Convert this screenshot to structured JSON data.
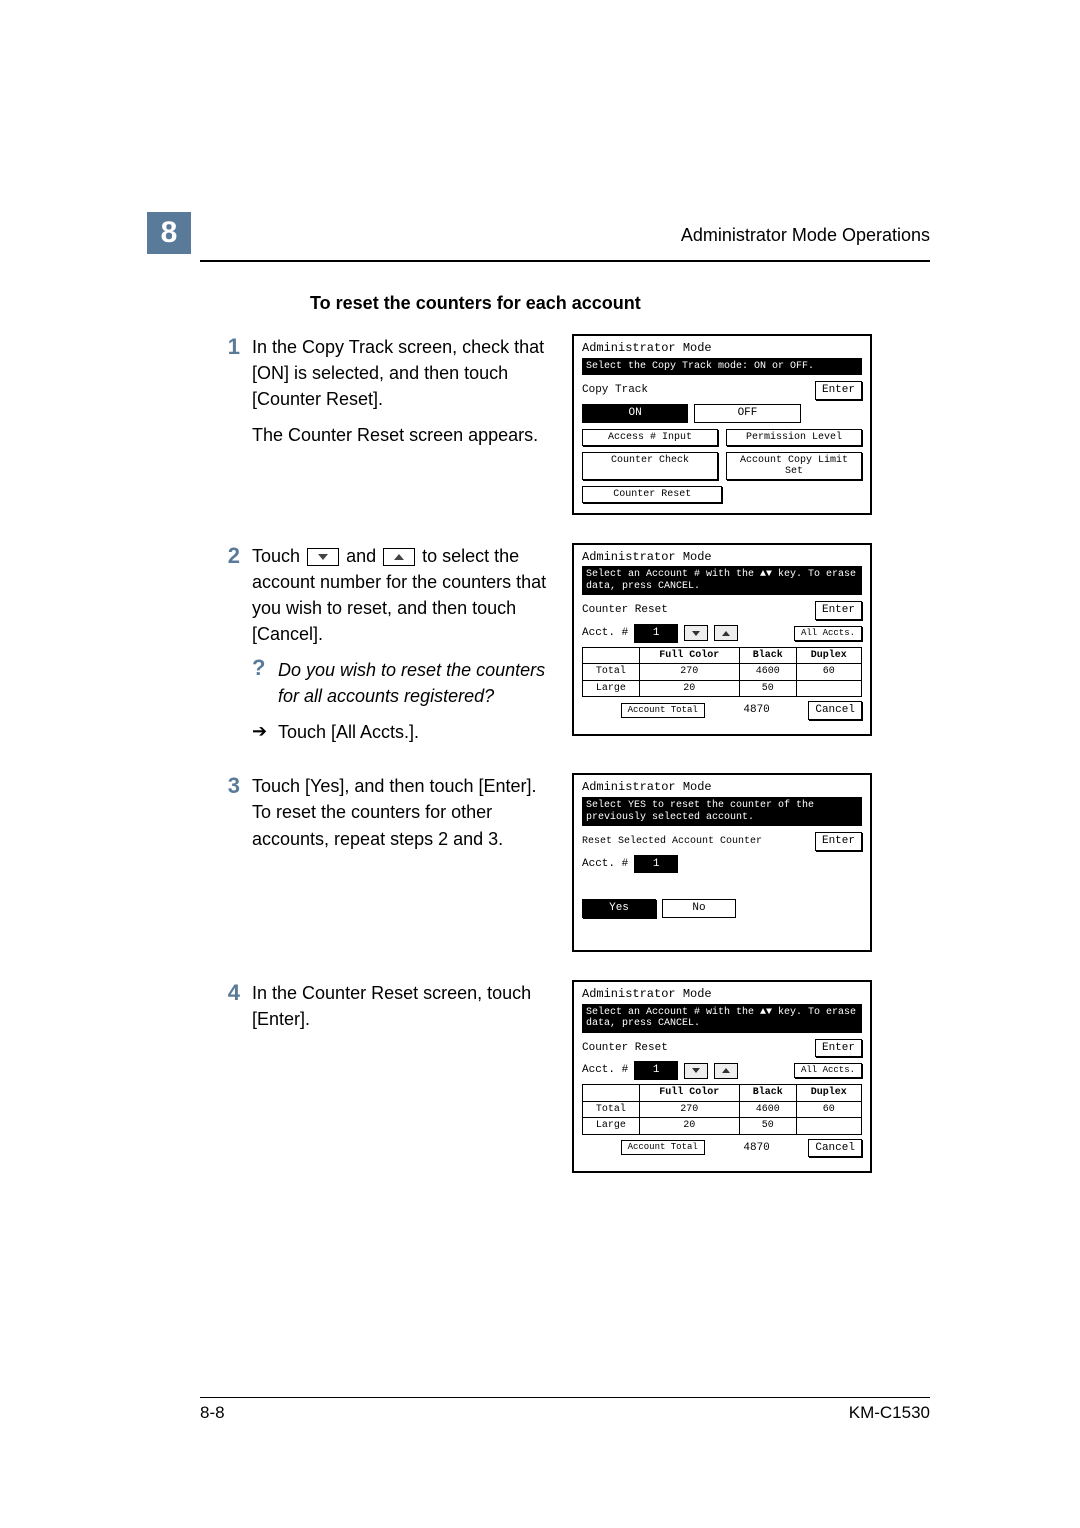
{
  "header": {
    "chapter_number": "8",
    "right_title": "Administrator Mode Operations"
  },
  "section_heading": "To reset the counters for each account",
  "steps": {
    "s1": {
      "num": "1",
      "p1": "In the Copy Track screen, check that [ON] is selected, and then touch [Counter Reset].",
      "p2": "The Counter Reset screen appears."
    },
    "s2": {
      "num": "2",
      "pre": "Touch ",
      "mid": " and ",
      "post": " to select the account number for the counters that you wish to reset, and then touch [Cancel].",
      "q": "Do you wish to reset the counters for all accounts registered?",
      "arrow_text": "Touch [All Accts.]."
    },
    "s3": {
      "num": "3",
      "p1": "Touch [Yes], and then touch [Enter]. To reset the counters for other accounts, repeat steps 2 and 3."
    },
    "s4": {
      "num": "4",
      "p1": "In the Counter Reset screen, touch [Enter]."
    }
  },
  "panels": {
    "p1": {
      "title": "Administrator Mode",
      "msg": "Select the Copy Track mode: ON or OFF.",
      "copy_track": "Copy Track",
      "enter": "Enter",
      "on": "ON",
      "off": "OFF",
      "b1": "Access # Input",
      "b2": "Permission Level",
      "b3": "Counter Check",
      "b4": "Account Copy Limit Set",
      "b5": "Counter Reset"
    },
    "p_counter": {
      "title": "Administrator Mode",
      "msg": "Select an Account # with the ▲▼ key. To erase data, press CANCEL.",
      "cr": "Counter Reset",
      "enter": "Enter",
      "acct_label": "Acct. #",
      "acct_value": "1",
      "all": "All Accts.",
      "h1": "Full Color",
      "h2": "Black",
      "h3": "Duplex",
      "r_total": "Total",
      "r_large": "Large",
      "accttot": "Account Total",
      "cancel": "Cancel"
    },
    "p3": {
      "title": "Administrator Mode",
      "msg": "Select YES to reset the counter of the previously selected account.",
      "sub": "Reset Selected Account Counter",
      "enter": "Enter",
      "acct_label": "Acct. #",
      "acct_value": "1",
      "yes": "Yes",
      "no": "No"
    }
  },
  "chart_data": {
    "type": "table",
    "title": "Counter Reset",
    "columns": [
      "",
      "Full Color",
      "Black",
      "Duplex"
    ],
    "rows": [
      {
        "label": "Total",
        "values": [
          270,
          4600,
          60
        ]
      },
      {
        "label": "Large",
        "values": [
          20,
          50,
          null
        ]
      }
    ],
    "account_total": 4870
  },
  "footer": {
    "left": "8-8",
    "right": "KM-C1530"
  }
}
